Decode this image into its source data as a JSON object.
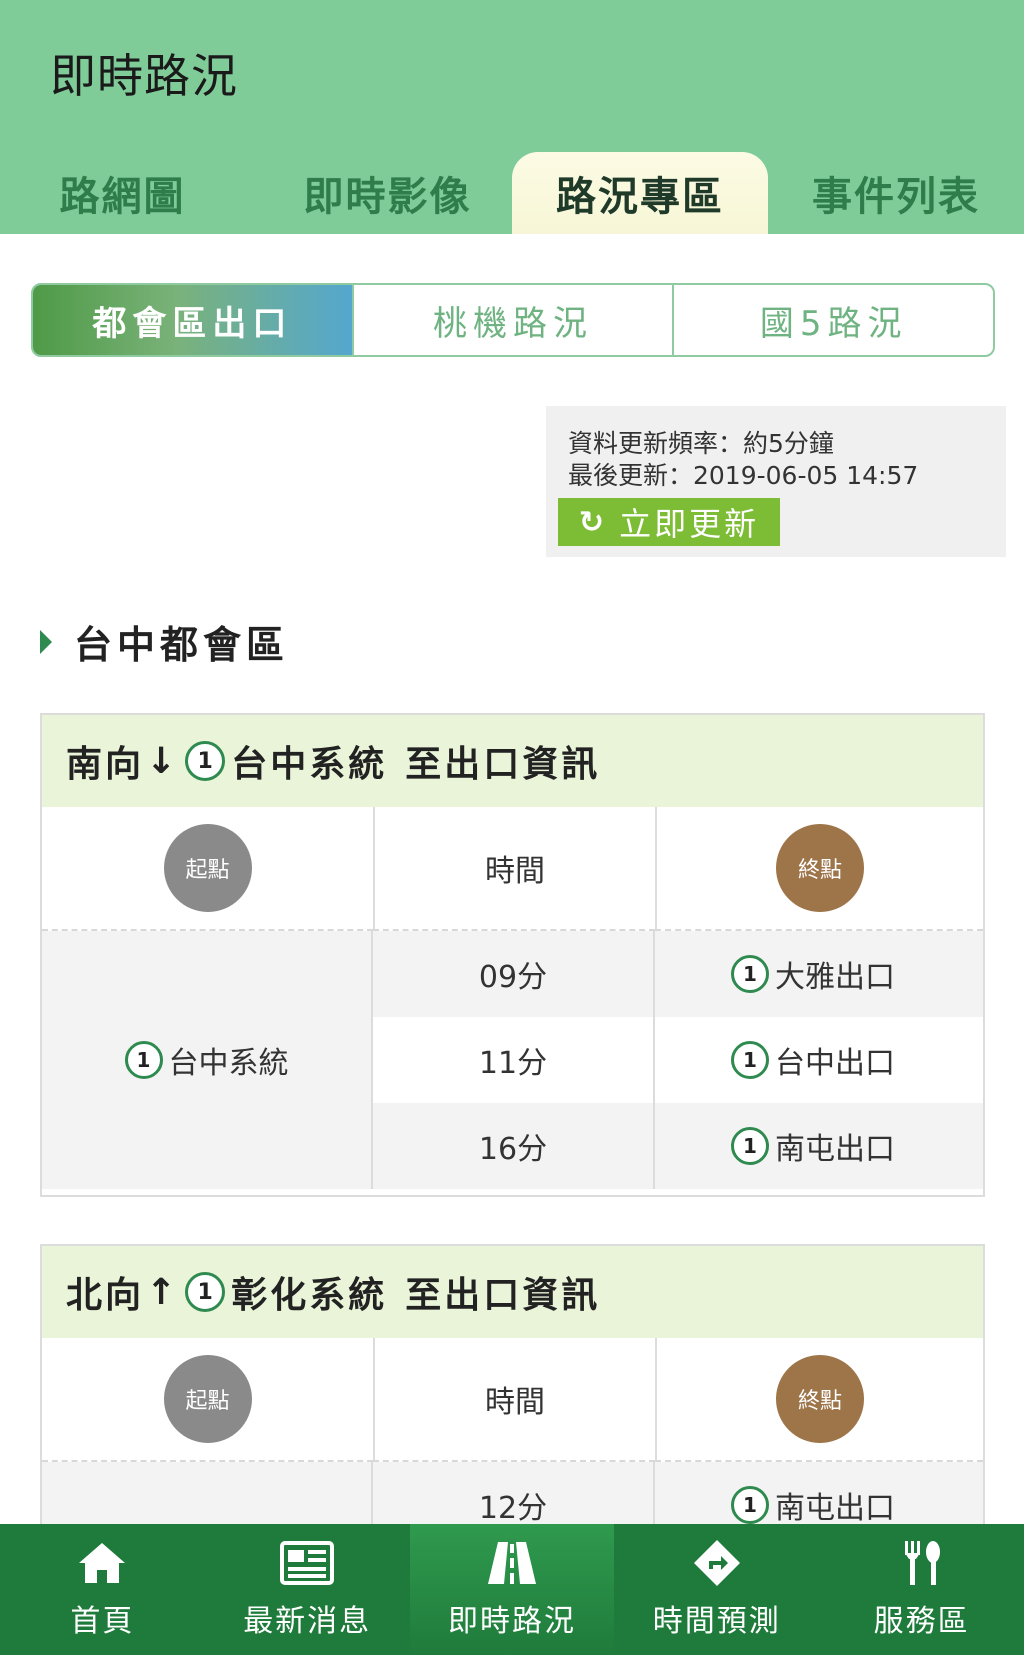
{
  "header": {
    "title": "即時路況",
    "tabs": [
      {
        "label": "路網圖"
      },
      {
        "label": "即時影像"
      },
      {
        "label": "路況專區"
      },
      {
        "label": "事件列表"
      }
    ]
  },
  "segments": [
    {
      "label": "都會區出口"
    },
    {
      "label": "桃機路況"
    },
    {
      "label": "國5路況"
    }
  ],
  "update": {
    "frequency": "資料更新頻率：約5分鐘",
    "last_update": "最後更新：2019-06-05 14:57",
    "refresh_label": "立即更新",
    "refresh_icon": "↻"
  },
  "section": {
    "title": "台中都會區"
  },
  "highway_number": "1",
  "table_header": {
    "start": "起點",
    "time": "時間",
    "end": "終點"
  },
  "cards": [
    {
      "direction": "南向",
      "arrow": "↓",
      "system": "台中系統",
      "suffix": "至出口資訊",
      "origin": "台中系統",
      "rows": [
        {
          "time": "09分",
          "dest": "大雅出口"
        },
        {
          "time": "11分",
          "dest": "台中出口"
        },
        {
          "time": "16分",
          "dest": "南屯出口"
        }
      ]
    },
    {
      "direction": "北向",
      "arrow": "↑",
      "system": "彰化系統",
      "suffix": "至出口資訊",
      "rows": [
        {
          "time": "12分",
          "dest": "南屯出口"
        }
      ]
    }
  ],
  "bottom_nav": [
    {
      "label": "首頁",
      "icon": "home-icon"
    },
    {
      "label": "最新消息",
      "icon": "news-icon"
    },
    {
      "label": "即時路況",
      "icon": "road-icon"
    },
    {
      "label": "時間預測",
      "icon": "direction-sign-icon"
    },
    {
      "label": "服務區",
      "icon": "fork-knife-icon"
    }
  ],
  "colors": {
    "header_bg": "#7fcc98",
    "tab_text": "#2e7d4a",
    "accent_green": "#7cbd35",
    "card_head_bg": "#e9f4d9",
    "start_dot": "#8a8a8a",
    "end_dot": "#9e7449",
    "nav_bg": "#1f7b3b"
  }
}
